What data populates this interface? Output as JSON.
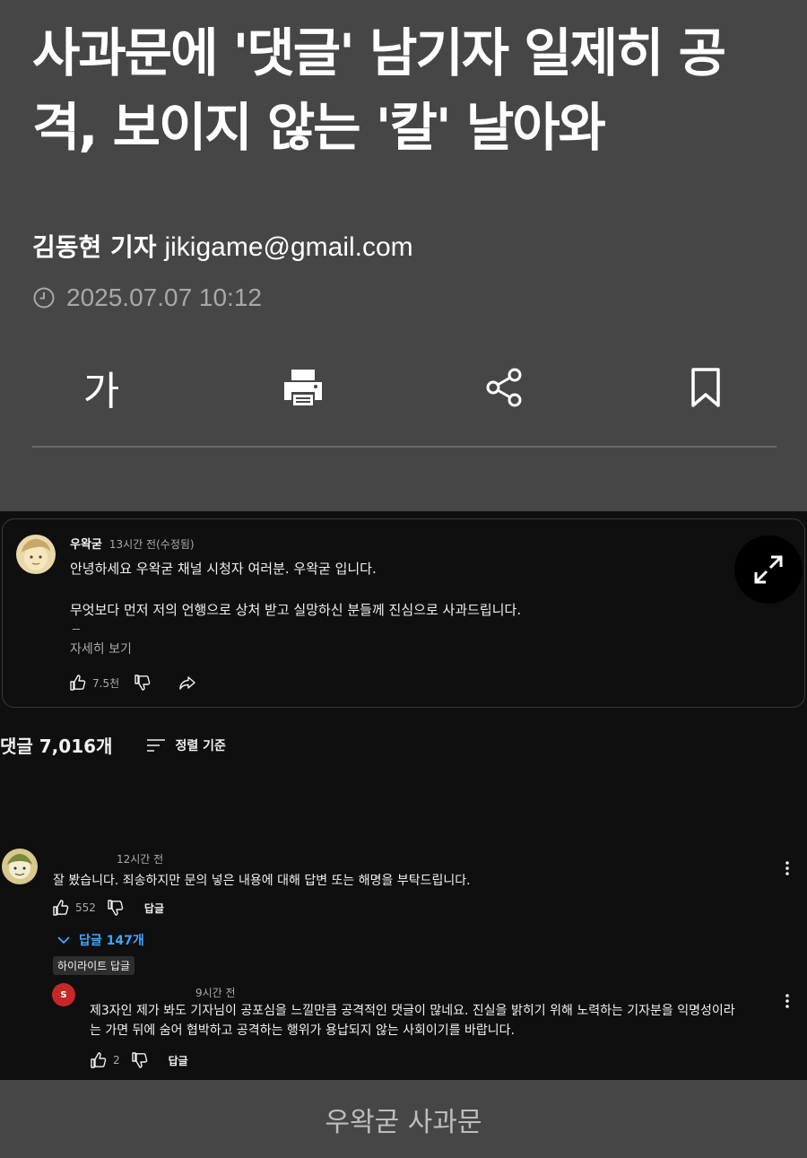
{
  "article": {
    "headline_line1": "사과문에 '댓글' 남기자 일제히 공",
    "headline_line2": "격, 보이지 않는 '칼' 날아와",
    "author": "김동현 기자",
    "email": "jikigame@gmail.com",
    "date": "2025.07.07 10:12",
    "font_size_label": "가"
  },
  "screenshot": {
    "pinned_comment": {
      "channel": "우왁굳",
      "time": "13시간 전(수정됨)",
      "line1": "안녕하세요 우왁굳 채널 시청자 여러분. 우왁굳 입니다.",
      "line2": "무엇보다 먼저 저의 언행으로 상처 받고 실망하신 분들께 진심으로 사과드립니다.",
      "more": "자세히 보기",
      "likes": "7.5천"
    },
    "comments_count": "댓글 7,016개",
    "sort_label": "정렬 기준",
    "comment": {
      "time": "12시간 전",
      "text": "잘 봤습니다. 죄송하지만 문의 넣은 내용에 대해 답변 또는 해명을 부탁드립니다.",
      "likes": "552",
      "reply_label": "답글",
      "replies_toggle": "답글 147개",
      "highlight_badge": "하이라이트 답글"
    },
    "reply": {
      "avatar_letter": "S",
      "time": "9시간 전",
      "line1": "제3자인 제가 봐도 기자님이 공포심을 느낄만큼 공격적인 댓글이 많네요. 진실을 밝히기 위해 노력하는 기자분을 익명성이라",
      "line2": "는 가면 뒤에 숨어 협박하고 공격하는 행위가 용납되지 않는 사회이기를 바랍니다.",
      "likes": "2",
      "reply_label": "답글"
    }
  },
  "caption": "우왁굳 사과문",
  "colors": {
    "article_bg": "#464646",
    "screenshot_bg": "#0f0f0f",
    "link_blue": "#3ea6ff",
    "reply_avatar": "#c62828"
  }
}
